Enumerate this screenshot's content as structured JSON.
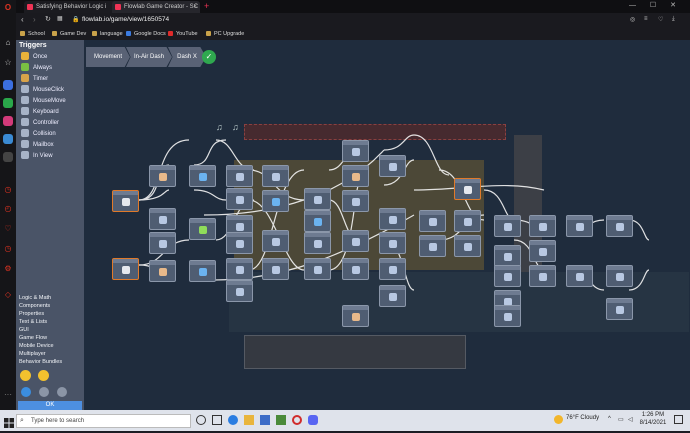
{
  "browser": {
    "tabs": [
      {
        "title": "Satisfying Behavior Logic i"
      },
      {
        "title": "Flowlab Game Creator - SC"
      }
    ],
    "add_tab": "+",
    "url": "flowlab.io/game/view/1650574",
    "bookmarks": [
      "School",
      "Game Dev",
      "language",
      "Google Docs",
      "YouTube",
      "PC Upgrade"
    ]
  },
  "sidebar": {
    "triggers_heading": "Triggers",
    "triggers": [
      {
        "label": "Once",
        "color": "#e8b23a"
      },
      {
        "label": "Always",
        "color": "#7ac043"
      },
      {
        "label": "Timer",
        "color": "#d9a34a"
      },
      {
        "label": "MouseClick",
        "color": "#a7b3c7"
      },
      {
        "label": "MouseMove",
        "color": "#a7b3c7"
      },
      {
        "label": "Keyboard",
        "color": "#a7b3c7"
      },
      {
        "label": "Controller",
        "color": "#a7b3c7"
      },
      {
        "label": "Collision",
        "color": "#a7b3c7"
      },
      {
        "label": "Mailbox",
        "color": "#a7b3c7"
      },
      {
        "label": "In View",
        "color": "#a7b3c7"
      }
    ],
    "categories": [
      "Logic & Math",
      "Components",
      "Properties",
      "Text & Lists",
      "GUI",
      "Game Flow",
      "Mobile Device",
      "Multiplayer",
      "Behavior Bundles"
    ],
    "ok_label": "OK"
  },
  "editor": {
    "breadcrumbs": [
      "Movement",
      "In-Air Dash",
      "Dash X"
    ]
  },
  "taskbar": {
    "search_placeholder": "Type here to search",
    "weather": "76°F  Cloudy",
    "time": "1:26 PM",
    "date": "8/14/2021"
  }
}
